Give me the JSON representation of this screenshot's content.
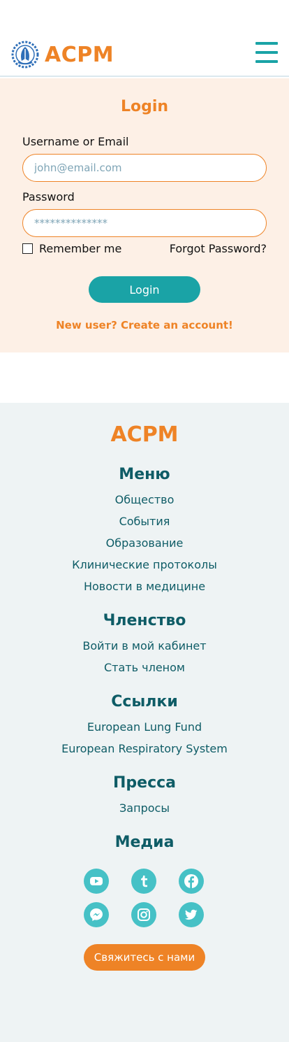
{
  "header": {
    "logo_text": "ACPM",
    "menu_icon": "hamburger-menu-icon"
  },
  "login": {
    "title": "Login",
    "username_label": "Username or Email",
    "username_placeholder": "john@email.com",
    "password_label": "Password",
    "password_placeholder": "**************",
    "remember_label": "Remember me",
    "forgot_label": "Forgot Password?",
    "submit_label": "Login",
    "create_account": "New user? Create an account!"
  },
  "footer": {
    "logo_text": "ACPM",
    "sections": {
      "menu": {
        "title": "Меню",
        "links": [
          "Общество",
          "События",
          "Образование",
          "Клинические протоколы",
          "Новости в медицине"
        ]
      },
      "membership": {
        "title": "Членство",
        "links": [
          "Войти в мой кабинет",
          "Стать членом"
        ]
      },
      "links": {
        "title": "Ссылки",
        "links": [
          "European Lung Fund",
          "European Respiratory System"
        ]
      },
      "press": {
        "title": "Пресса",
        "links": [
          "Запросы"
        ]
      },
      "media": {
        "title": "Медиа",
        "icons": [
          "youtube-icon",
          "tumblr-icon",
          "facebook-icon",
          "messenger-icon",
          "instagram-icon",
          "twitter-icon"
        ]
      }
    },
    "contact_label": "Свяжитесь с нами"
  },
  "colors": {
    "brand_orange": "#ee8326",
    "teal": "#1aa3a6",
    "social_teal": "#46c1c6",
    "dark_teal_text": "#0e5c66",
    "login_bg": "#fdf0e6",
    "footer_bg": "#eef3f4"
  }
}
